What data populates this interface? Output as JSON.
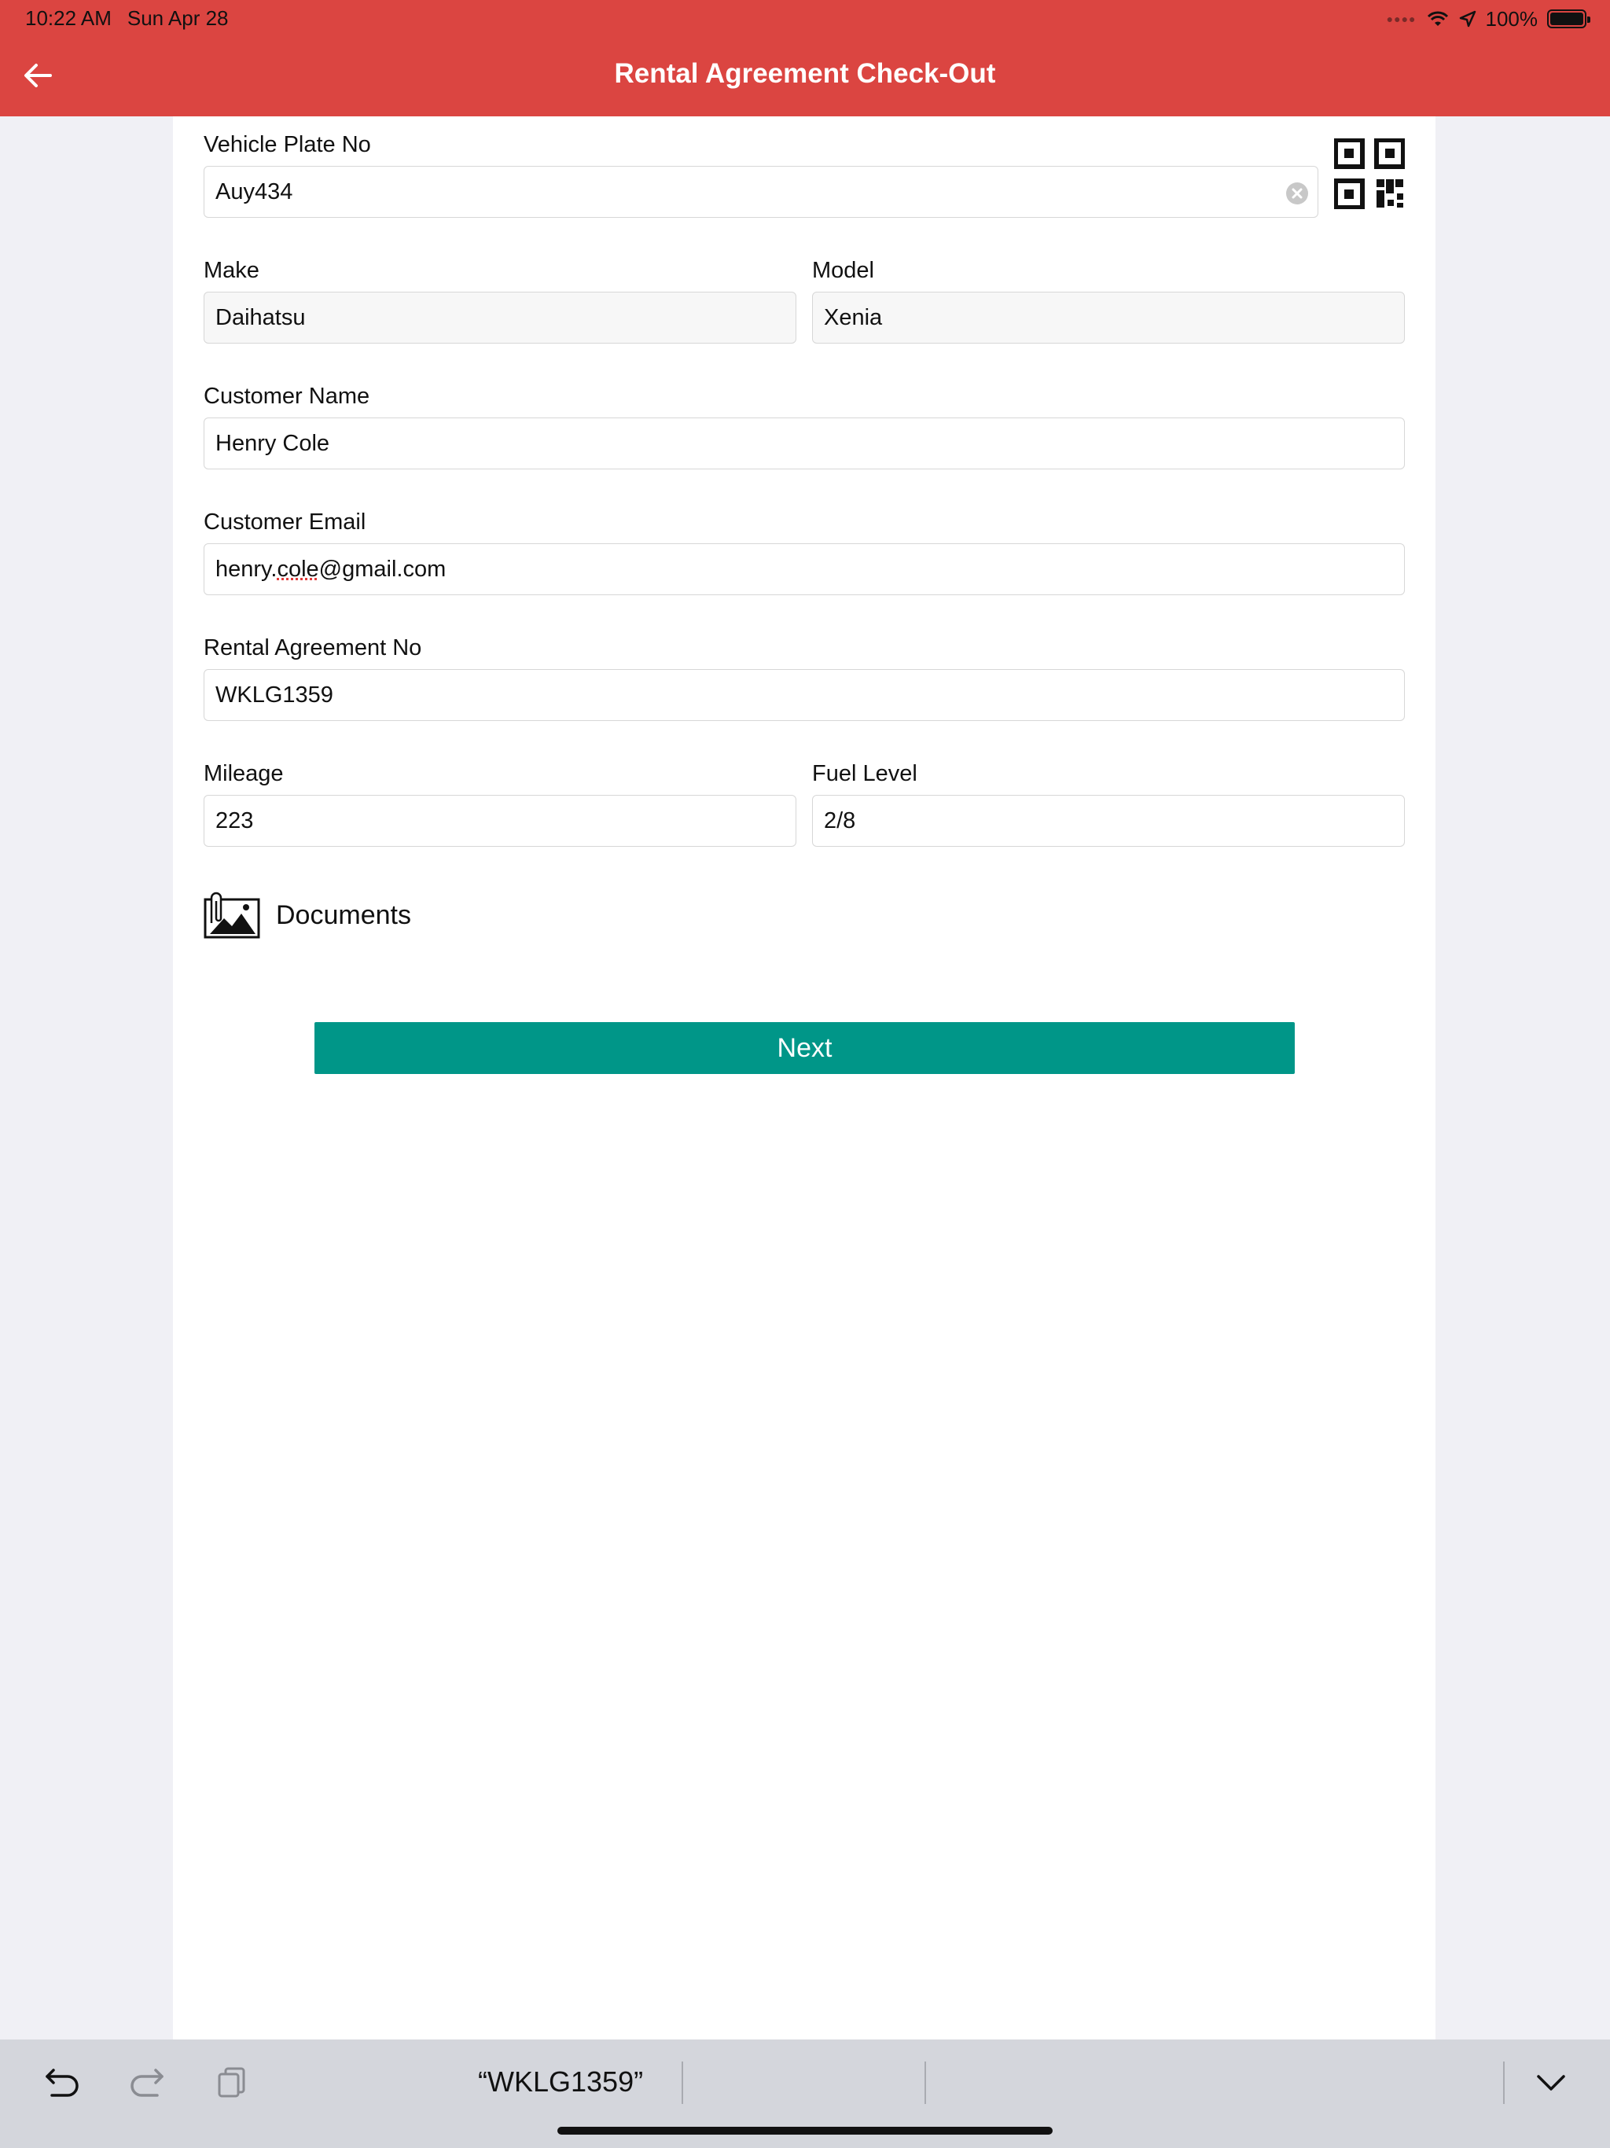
{
  "status_bar": {
    "time": "10:22 AM",
    "date": "Sun Apr 28",
    "battery": "100%"
  },
  "nav": {
    "title": "Rental Agreement Check-Out",
    "back_icon": "arrow-left-icon"
  },
  "form": {
    "vehicle_plate": {
      "label": "Vehicle Plate No",
      "value": "Auy434"
    },
    "make": {
      "label": "Make",
      "value": "Daihatsu"
    },
    "model": {
      "label": "Model",
      "value": "Xenia"
    },
    "customer_name": {
      "label": "Customer Name",
      "value": "Henry Cole"
    },
    "customer_email": {
      "label": "Customer Email",
      "value_prefix": "henry.",
      "value_misspelled": "cole",
      "value_suffix": "@gmail.com"
    },
    "rental_agreement_no": {
      "label": "Rental Agreement No",
      "value": "WKLG1359"
    },
    "mileage": {
      "label": "Mileage",
      "value": "223"
    },
    "fuel_level": {
      "label": "Fuel Level",
      "value": "2/8"
    }
  },
  "documents": {
    "label": "Documents",
    "icon": "attachment-image-icon"
  },
  "next_button": {
    "label": "Next",
    "color": "#009688"
  },
  "keyboard_bar": {
    "suggestion": "“WKLG1359”"
  },
  "colors": {
    "header": "#db4541",
    "background": "#f0f0f5",
    "accent": "#009688"
  }
}
